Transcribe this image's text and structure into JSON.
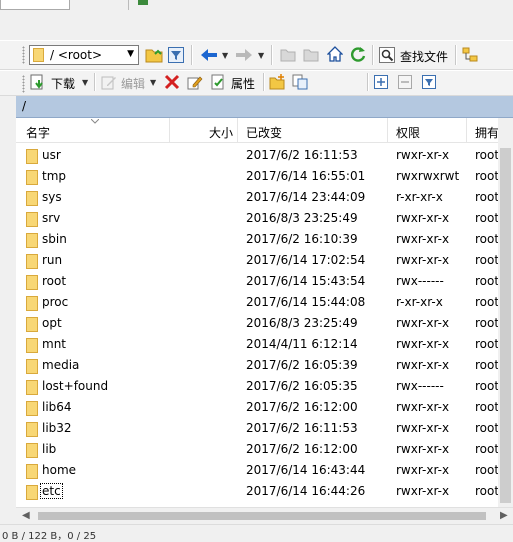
{
  "toolbar1": {
    "path_value": "/ <root>",
    "find_files_label": "查找文件"
  },
  "toolbar2": {
    "download_label": "下载",
    "edit_label": "编辑",
    "properties_label": "属性"
  },
  "address": {
    "path": "/"
  },
  "columns": {
    "name": "名字",
    "size": "大小",
    "modified": "已改变",
    "permissions": "权限",
    "owner": "拥有者"
  },
  "rows": [
    {
      "name": "usr",
      "modified": "2017/6/2 16:11:53",
      "permissions": "rwxr-xr-x",
      "owner": "root"
    },
    {
      "name": "tmp",
      "modified": "2017/6/14 16:55:01",
      "permissions": "rwxrwxrwt",
      "owner": "root"
    },
    {
      "name": "sys",
      "modified": "2017/6/14 23:44:09",
      "permissions": "r-xr-xr-x",
      "owner": "root"
    },
    {
      "name": "srv",
      "modified": "2016/8/3 23:25:49",
      "permissions": "rwxr-xr-x",
      "owner": "root"
    },
    {
      "name": "sbin",
      "modified": "2017/6/2 16:10:39",
      "permissions": "rwxr-xr-x",
      "owner": "root"
    },
    {
      "name": "run",
      "modified": "2017/6/14 17:02:54",
      "permissions": "rwxr-xr-x",
      "owner": "root"
    },
    {
      "name": "root",
      "modified": "2017/6/14 15:43:54",
      "permissions": "rwx------",
      "owner": "root"
    },
    {
      "name": "proc",
      "modified": "2017/6/14 15:44:08",
      "permissions": "r-xr-xr-x",
      "owner": "root"
    },
    {
      "name": "opt",
      "modified": "2016/8/3 23:25:49",
      "permissions": "rwxr-xr-x",
      "owner": "root"
    },
    {
      "name": "mnt",
      "modified": "2014/4/11 6:12:14",
      "permissions": "rwxr-xr-x",
      "owner": "root"
    },
    {
      "name": "media",
      "modified": "2017/6/2 16:05:39",
      "permissions": "rwxr-xr-x",
      "owner": "root"
    },
    {
      "name": "lost+found",
      "modified": "2017/6/2 16:05:35",
      "permissions": "rwx------",
      "owner": "root"
    },
    {
      "name": "lib64",
      "modified": "2017/6/2 16:12:00",
      "permissions": "rwxr-xr-x",
      "owner": "root"
    },
    {
      "name": "lib32",
      "modified": "2017/6/2 16:11:53",
      "permissions": "rwxr-xr-x",
      "owner": "root"
    },
    {
      "name": "lib",
      "modified": "2017/6/2 16:12:00",
      "permissions": "rwxr-xr-x",
      "owner": "root"
    },
    {
      "name": "home",
      "modified": "2017/6/14 16:43:44",
      "permissions": "rwxr-xr-x",
      "owner": "root"
    },
    {
      "name": "etc",
      "modified": "2017/6/14 16:44:26",
      "permissions": "rwxr-xr-x",
      "owner": "root"
    }
  ],
  "status": {
    "text": "0 B / 122 B，0 / 25"
  },
  "colors": {
    "address_bar": "#b4c8e0",
    "folder": "#f8d775",
    "accent_green": "#2e9a2e",
    "delete_red": "#d42020",
    "nav_blue": "#1c66d0"
  }
}
